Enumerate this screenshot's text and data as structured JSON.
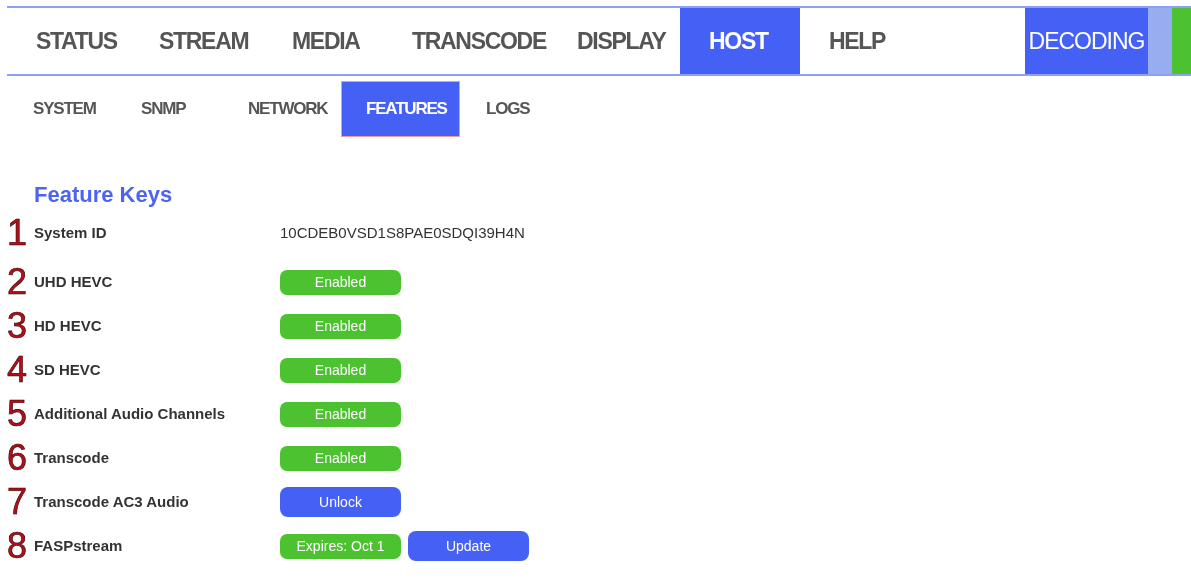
{
  "main_nav": [
    {
      "label": "STATUS",
      "selected": false
    },
    {
      "label": "STREAM",
      "selected": false
    },
    {
      "label": "MEDIA",
      "selected": false
    },
    {
      "label": "TRANSCODE",
      "selected": false
    },
    {
      "label": "DISPLAY",
      "selected": false
    },
    {
      "label": "HOST",
      "selected": true
    },
    {
      "label": "HELP",
      "selected": false
    }
  ],
  "mode": {
    "label": "DECODING"
  },
  "indicators": [
    {
      "color": "#98acf0"
    },
    {
      "color": "#4cc230"
    }
  ],
  "sub_nav": [
    {
      "label": "SYSTEM",
      "selected": false
    },
    {
      "label": "SNMP",
      "selected": false
    },
    {
      "label": "NETWORK",
      "selected": false
    },
    {
      "label": "FEATURES",
      "selected": true
    },
    {
      "label": "LOGS",
      "selected": false
    }
  ],
  "section_title": "Feature Keys",
  "features": [
    {
      "number": "1",
      "label": "System ID",
      "values": [
        {
          "kind": "text",
          "text": "10CDEB0VSD1S8PAE0SDQI39H4N"
        }
      ]
    },
    {
      "number": "2",
      "label": "UHD HEVC",
      "values": [
        {
          "kind": "status",
          "text": "Enabled"
        }
      ]
    },
    {
      "number": "3",
      "label": "HD HEVC",
      "values": [
        {
          "kind": "status",
          "text": "Enabled"
        }
      ]
    },
    {
      "number": "4",
      "label": "SD HEVC",
      "values": [
        {
          "kind": "status",
          "text": "Enabled"
        }
      ]
    },
    {
      "number": "5",
      "label": "Additional Audio Channels",
      "values": [
        {
          "kind": "status",
          "text": "Enabled"
        }
      ]
    },
    {
      "number": "6",
      "label": "Transcode",
      "values": [
        {
          "kind": "status",
          "text": "Enabled"
        }
      ]
    },
    {
      "number": "7",
      "label": "Transcode AC3 Audio",
      "values": [
        {
          "kind": "button",
          "text": "Unlock"
        }
      ]
    },
    {
      "number": "8",
      "label": "FASPstream",
      "values": [
        {
          "kind": "status",
          "text": "Expires: Oct 1"
        },
        {
          "kind": "button",
          "text": "Update"
        }
      ]
    }
  ]
}
